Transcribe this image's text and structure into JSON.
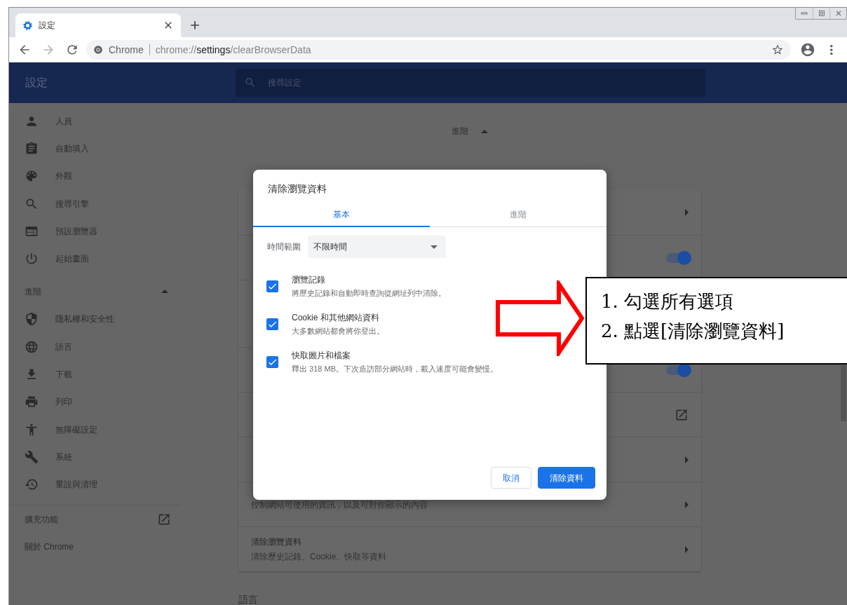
{
  "tab": {
    "title": "設定"
  },
  "address_bar": {
    "site_label": "Chrome",
    "url_scheme": "chrome://",
    "url_host": "settings",
    "url_path": "/clearBrowserData"
  },
  "header": {
    "title": "設定",
    "search": {
      "placeholder": "搜尋設定"
    }
  },
  "sidebar": {
    "items": [
      {
        "label": "人員"
      },
      {
        "label": "自動填入"
      },
      {
        "label": "外觀"
      },
      {
        "label": "搜尋引擎"
      },
      {
        "label": "預設瀏覽器"
      },
      {
        "label": "起始畫面"
      }
    ],
    "advanced": {
      "label": "進階",
      "expanded": true
    },
    "advanced_items": [
      {
        "label": "隱私權和安全性"
      },
      {
        "label": "語言"
      },
      {
        "label": "下載"
      },
      {
        "label": "列印"
      },
      {
        "label": "無障礙設定"
      },
      {
        "label": "系統"
      },
      {
        "label": "重設與清理"
      }
    ],
    "footer": [
      {
        "label": "擴充功能",
        "external": true
      },
      {
        "label": "關於 Chrome"
      }
    ]
  },
  "main": {
    "advanced_toggle": {
      "label": "進階",
      "expanded": true
    },
    "card_rows": [
      {
        "kind": "chevron"
      },
      {
        "kind": "toggle",
        "on": true
      },
      {
        "kind": "none"
      },
      {
        "kind": "toggle",
        "on": true
      },
      {
        "kind": "external"
      },
      {
        "kind": "chevron"
      },
      {
        "kind": "chevron",
        "subtitle": "控制網站可使用的資訊，以及可對你顯示的內容"
      },
      {
        "kind": "chevron",
        "title": "清除瀏覽資料",
        "subtitle": "清除歷史記錄、Cookie、快取等資料"
      }
    ],
    "next_section_title": "語言"
  },
  "dialog": {
    "title": "清除瀏覽資料",
    "tabs": [
      {
        "label": "基本",
        "selected": true
      },
      {
        "label": "進階",
        "selected": false
      }
    ],
    "time_range": {
      "label": "時間範圍",
      "value": "不限時間"
    },
    "options": [
      {
        "title": "瀏覽記錄",
        "description": "將歷史記錄和自動即時查詢從網址列中清除。",
        "checked": true
      },
      {
        "title": "Cookie 和其他網站資料",
        "description": "大多數網站都會將你登出。",
        "checked": true
      },
      {
        "title": "快取圖片和檔案",
        "description": "釋出 318 MB。下次造訪部分網站時，載入速度可能會變慢。",
        "checked": true
      }
    ],
    "buttons": [
      {
        "label": "取消",
        "kind": "secondary"
      },
      {
        "label": "清除資料",
        "kind": "primary"
      }
    ]
  },
  "callout": {
    "steps": [
      "1. 勾選所有選項",
      "2. 點選[清除瀏覽資料]"
    ]
  }
}
